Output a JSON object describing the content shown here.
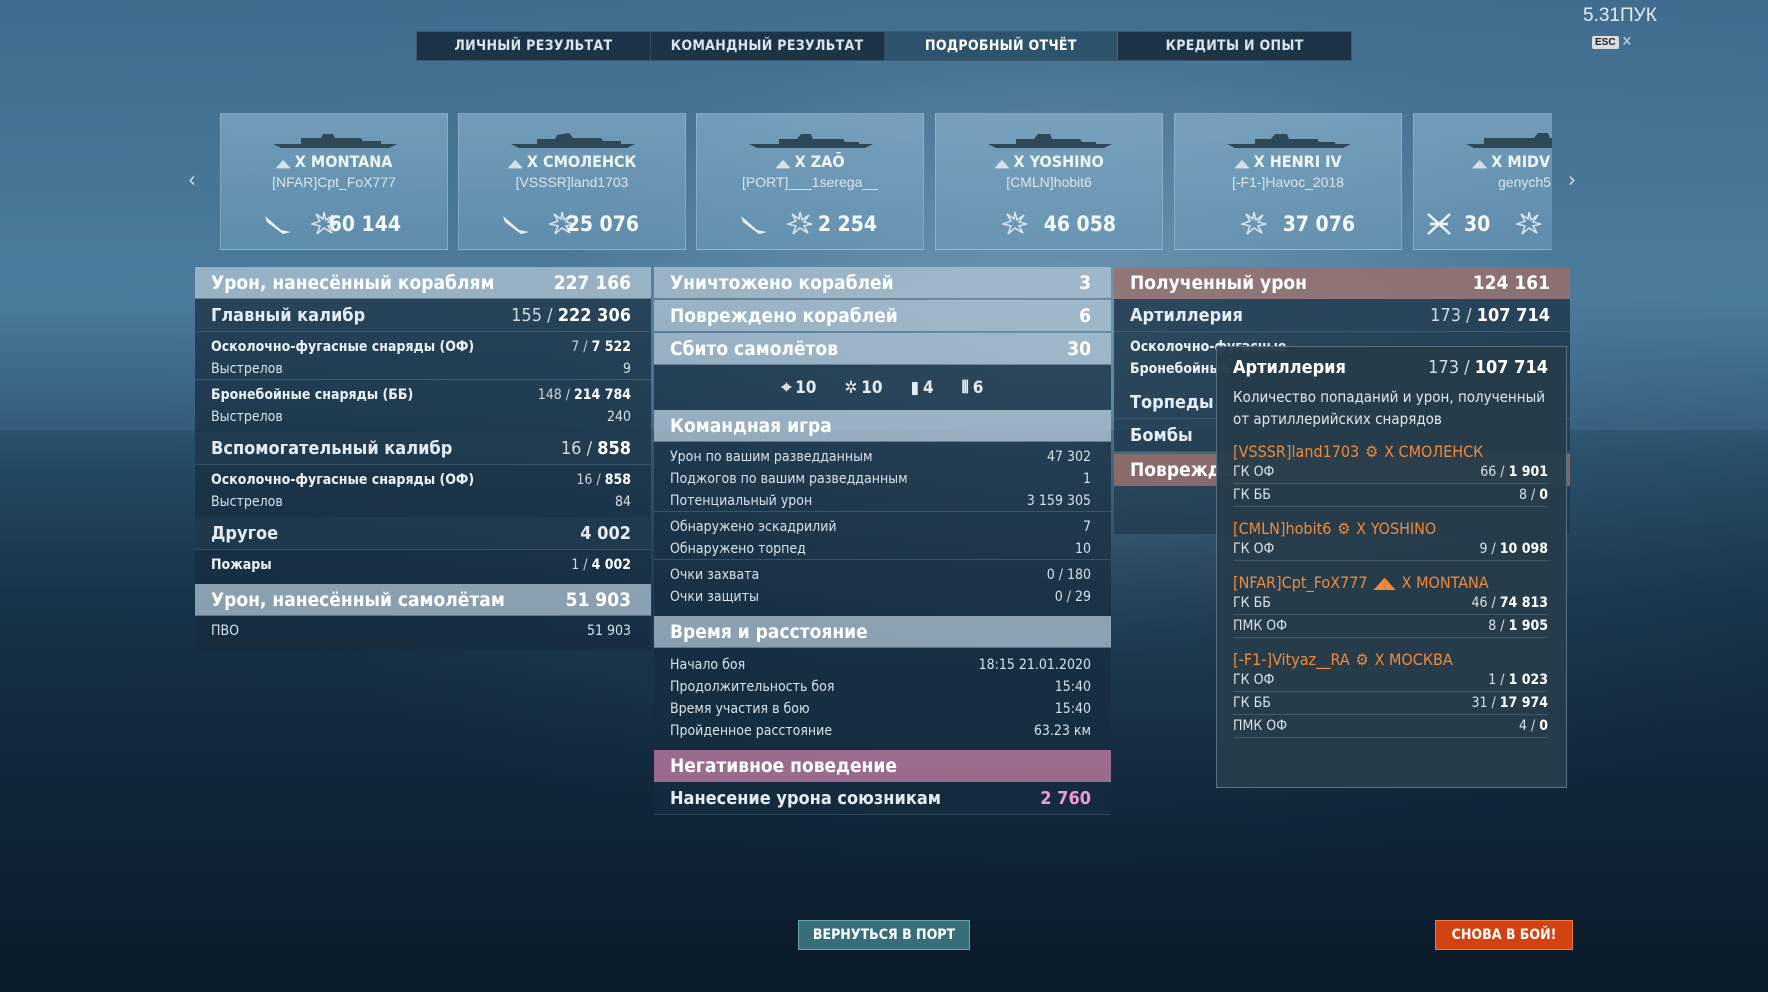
{
  "ping": "5.31ПУК",
  "esc_key": "ESC",
  "tabs": [
    "ЛИЧНЫЙ РЕЗУЛЬТАТ",
    "КОМАНДНЫЙ РЕЗУЛЬТАТ",
    "ПОДРОБНЫЙ ОТЧЁТ",
    "КРЕДИТЫ И ОПЫТ"
  ],
  "ships": [
    {
      "tier": "X",
      "name": "MONTANA",
      "player": "[NFAR]Cpt_FoX777",
      "value": "60 144"
    },
    {
      "tier": "X",
      "name": "СМОЛЕНСК",
      "player": "[VSSSR]land1703",
      "value": "25 076"
    },
    {
      "tier": "X",
      "name": "ZAŌ",
      "player": "[PORT]___1serega__",
      "value": "2 254"
    },
    {
      "tier": "X",
      "name": "YOSHINO",
      "player": "[CMLN]hobit6",
      "value": "46 058"
    },
    {
      "tier": "X",
      "name": "HENRI IV",
      "player": "[-F1-]Havoc_2018",
      "value": "37 076"
    },
    {
      "tier": "X",
      "name": "MIDV",
      "player": "genych5",
      "value": "30"
    }
  ],
  "left": {
    "damage_ships": {
      "label": "Урон, нанесённый кораблям",
      "value": "227 166"
    },
    "main_battery": {
      "label": "Главный калибр",
      "hits": "155",
      "dmg": "222 306"
    },
    "he": {
      "label": "Осколочно-фугасные снаряды (ОФ)",
      "hits": "7",
      "dmg": "7 522"
    },
    "he_shots": {
      "label": "Выстрелов",
      "value": "9"
    },
    "ap": {
      "label": "Бронебойные снаряды (ББ)",
      "hits": "148",
      "dmg": "214 784"
    },
    "ap_shots": {
      "label": "Выстрелов",
      "value": "240"
    },
    "secondary": {
      "label": "Вспомогательный калибр",
      "hits": "16",
      "dmg": "858"
    },
    "sec_he": {
      "label": "Осколочно-фугасные снаряды (ОФ)",
      "hits": "16",
      "dmg": "858"
    },
    "sec_shots": {
      "label": "Выстрелов",
      "value": "84"
    },
    "other": {
      "label": "Другое",
      "value": "4 002"
    },
    "fires": {
      "label": "Пожары",
      "hits": "1",
      "dmg": "4 002"
    },
    "damage_planes": {
      "label": "Урон, нанесённый самолётам",
      "value": "51 903"
    },
    "aa": {
      "label": "ПВО",
      "value": "51 903"
    }
  },
  "middle": {
    "destroyed": {
      "label": "Уничтожено кораблей",
      "value": "3"
    },
    "damaged": {
      "label": "Повреждено кораблей",
      "value": "6"
    },
    "planes": {
      "label": "Сбито самолётов",
      "value": "30"
    },
    "plane_icons": [
      "10",
      "10",
      "4",
      "6"
    ],
    "team_play": "Командная игра",
    "spotting_damage": {
      "label": "Урон по вашим разведданным",
      "value": "47 302"
    },
    "spotting_fires": {
      "label": "Поджогов по вашим разведданным",
      "value": "1"
    },
    "potential": {
      "label": "Потенциальный урон",
      "value": "3 159 305"
    },
    "squadrons": {
      "label": "Обнаружено эскадрилий",
      "value": "7"
    },
    "torpedoes": {
      "label": "Обнаружено торпед",
      "value": "10"
    },
    "capture": {
      "label": "Очки захвата",
      "value": "0 / 180"
    },
    "defense": {
      "label": "Очки защиты",
      "value": "0 / 29"
    },
    "time_distance": "Время и расстояние",
    "start": {
      "label": "Начало боя",
      "value": "18:15  21.01.2020"
    },
    "duration": {
      "label": "Продолжительность боя",
      "value": "15:40"
    },
    "participation": {
      "label": "Время участия в бою",
      "value": "15:40"
    },
    "distance": {
      "label": "Пройденное расстояние",
      "value": "63.23 км"
    },
    "negative": "Негативное поведение",
    "team_damage": {
      "label": "Нанесение урона союзникам",
      "value": "2 760"
    }
  },
  "right": {
    "received": {
      "label": "Полученный урон",
      "value": "124 161"
    },
    "artillery": {
      "label": "Артиллерия",
      "hits": "173",
      "dmg": "107 714"
    },
    "r_he": "Осколочно-фугасные",
    "r_ap": "Бронебойные",
    "torps": "Торпеды",
    "bombs": "Бомбы",
    "damage_partial": "Поврежд..."
  },
  "tooltip": {
    "title": "Артиллерия",
    "hits": "173",
    "dmg": "107 714",
    "description": "Количество попаданий и урон, полученный от артиллерийских снарядов",
    "sources": [
      {
        "player": "[VSSSR]land1703",
        "ship": "X СМОЛЕНСК",
        "rows": [
          {
            "label": "ГК ОФ",
            "hits": "66",
            "dmg": "1 901"
          },
          {
            "label": "ГК ББ",
            "hits": "8",
            "dmg": "0"
          }
        ]
      },
      {
        "player": "[CMLN]hobit6",
        "ship": "X YOSHINO",
        "rows": [
          {
            "label": "ГК ОФ",
            "hits": "9",
            "dmg": "10 098"
          }
        ]
      },
      {
        "player": "[NFAR]Cpt_FoX777",
        "ship": "X MONTANA",
        "rows": [
          {
            "label": "ГК ББ",
            "hits": "46",
            "dmg": "74 813"
          },
          {
            "label": "ПМК ОФ",
            "hits": "8",
            "dmg": "1 905"
          }
        ]
      },
      {
        "player": "[-F1-]Vityaz__RA",
        "ship": "X МОСКВА",
        "rows": [
          {
            "label": "ГК ОФ",
            "hits": "1",
            "dmg": "1 023"
          },
          {
            "label": "ГК ББ",
            "hits": "31",
            "dmg": "17 974"
          },
          {
            "label": "ПМК ОФ",
            "hits": "4",
            "dmg": "0"
          }
        ]
      }
    ]
  },
  "buttons": {
    "port": "ВЕРНУТЬСЯ В ПОРТ",
    "battle": "СНОВА В БОЙ!"
  }
}
